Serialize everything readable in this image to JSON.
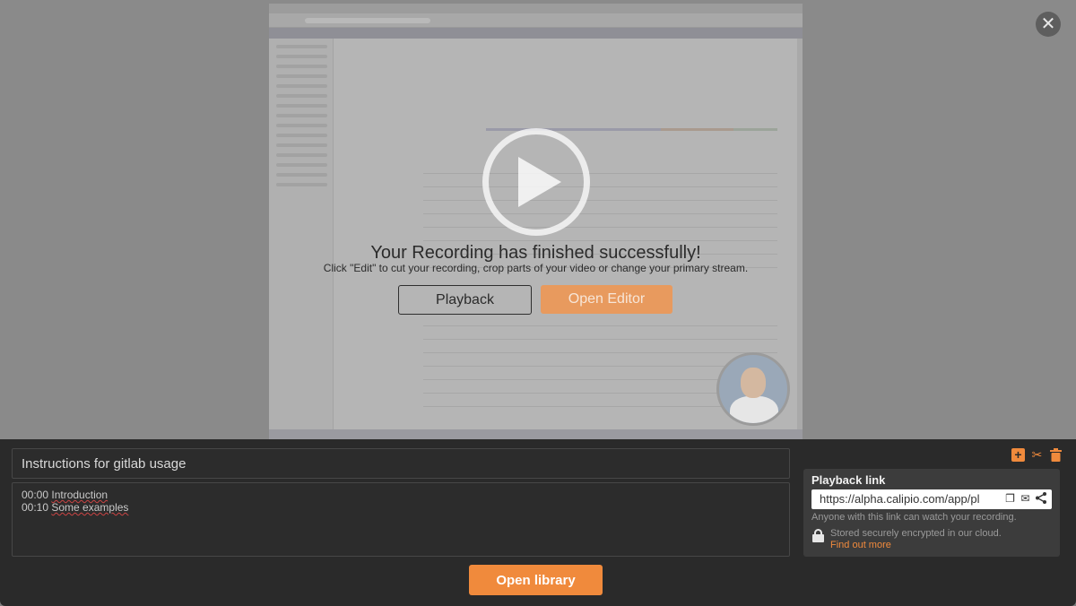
{
  "overlay": {
    "close_icon": "close-icon",
    "play_icon": "play-icon",
    "finished_title": "Your Recording has finished successfully!",
    "finished_subtitle": "Click \"Edit\" to cut your recording, crop parts of your video or change your primary stream.",
    "playback_label": "Playback",
    "open_editor_label": "Open Editor"
  },
  "recording": {
    "title": "Instructions for gitlab usage",
    "description_lines": [
      {
        "time": "00:00",
        "text": "Introduction"
      },
      {
        "time": "00:10",
        "text": "Some examples"
      }
    ]
  },
  "toolbar": {
    "icons": [
      "add-icon",
      "scissors-icon",
      "trash-icon"
    ]
  },
  "share": {
    "title": "Playback link",
    "link": "https://alpha.calipio.com/app/pl",
    "link_icons": [
      "copy-icon",
      "mail-icon",
      "share-icon"
    ],
    "note": "Anyone with this link can watch your recording.",
    "encryption_note": "Stored securely encrypted in our cloud.",
    "find_more": "Find out more"
  },
  "footer": {
    "open_library_label": "Open library"
  },
  "colors": {
    "accent": "#f08a3c",
    "panel_bg": "#2a2a2a"
  }
}
